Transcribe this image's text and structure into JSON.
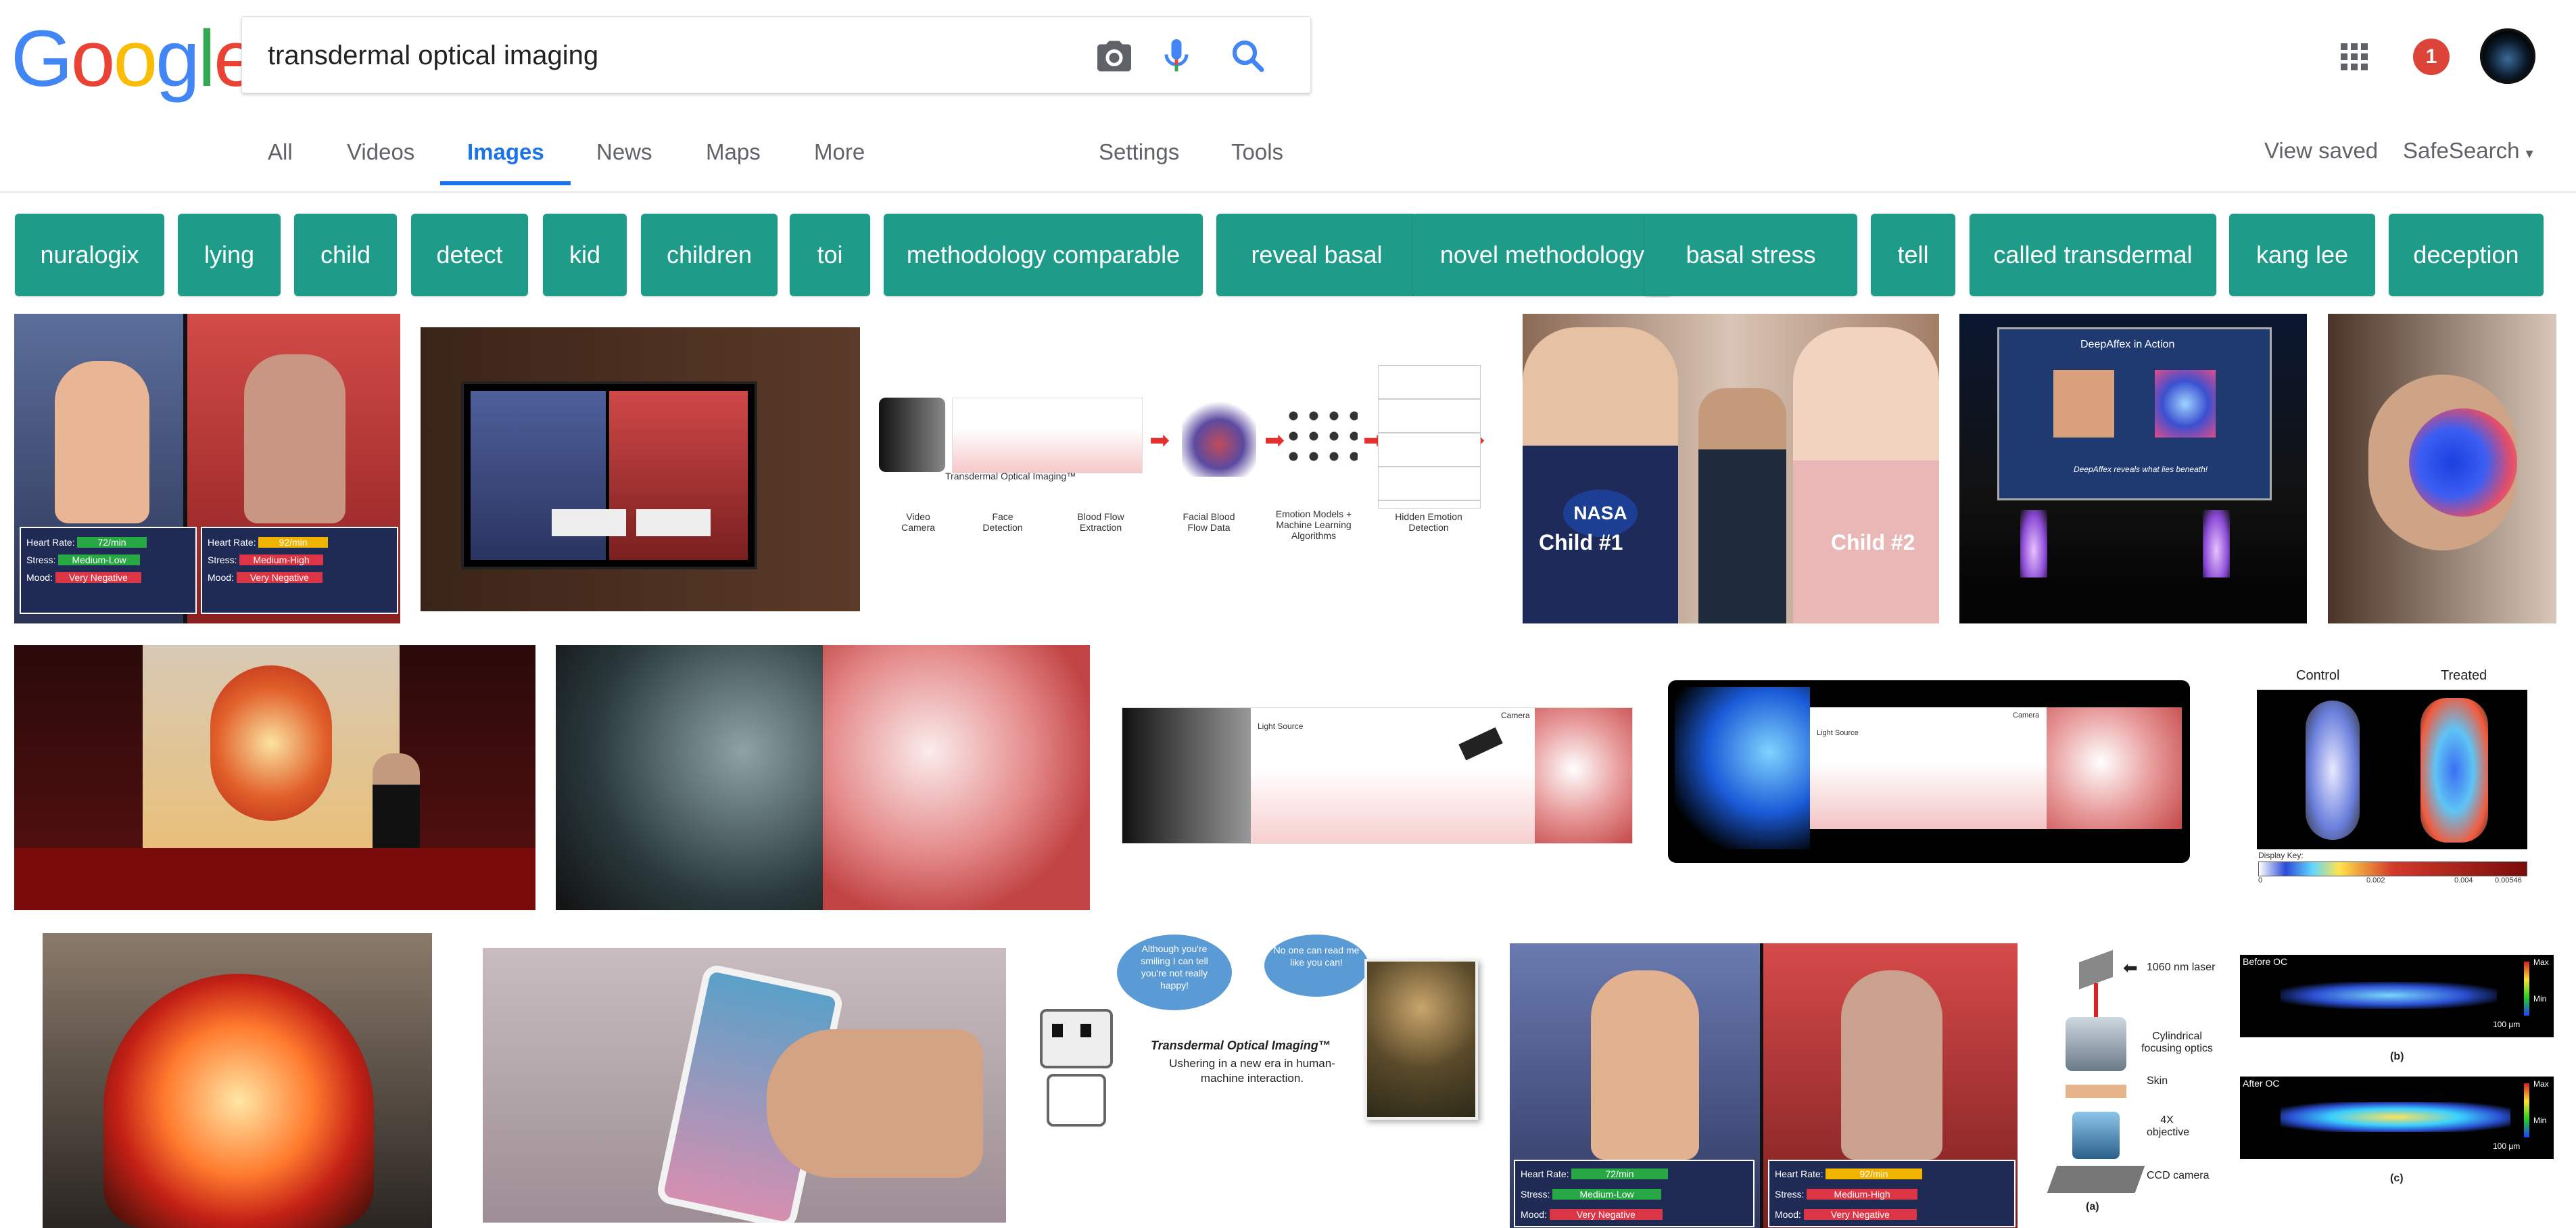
{
  "logo": {
    "letters": [
      "G",
      "o",
      "o",
      "g",
      "l",
      "e"
    ],
    "colors": [
      "#4285F4",
      "#EA4335",
      "#FBBC05",
      "#4285F4",
      "#34A853",
      "#EA4335"
    ]
  },
  "search": {
    "query": "transdermal optical imaging"
  },
  "header": {
    "notification_count": "1"
  },
  "tabs": {
    "all": "All",
    "videos": "Videos",
    "images": "Images",
    "news": "News",
    "maps": "Maps",
    "more": "More",
    "settings": "Settings",
    "tools": "Tools",
    "view_saved": "View saved",
    "safesearch": "SafeSearch"
  },
  "chips": [
    "nuralogix",
    "lying",
    "child",
    "detect",
    "kid",
    "children",
    "toi",
    "methodology comparable",
    "reveal basal",
    "novel methodology",
    "basal stress",
    "tell",
    "called transdermal",
    "kang lee",
    "deception"
  ],
  "images": {
    "r1_debate": {
      "rows": [
        [
          "Heart Rate:",
          "72/min"
        ],
        [
          "Stress:",
          "Medium-Low"
        ],
        [
          "Mood:",
          "Very Negative"
        ]
      ],
      "rows2": [
        [
          "Heart Rate:",
          "92/min"
        ],
        [
          "Stress:",
          "Medium-High"
        ],
        [
          "Mood:",
          "Very Negative"
        ]
      ]
    },
    "r1_diagram": {
      "title": "Transdermal Optical Imaging™",
      "steps": [
        "Video Camera",
        "Face Detection",
        "Blood Flow Extraction",
        "Facial Blood Flow Data",
        "Emotion Models + Machine Learning Algorithms",
        "Hidden Emotion Detection"
      ]
    },
    "r1_kids": {
      "left": "Child #1",
      "right": "Child #2",
      "shirt": "NASA"
    },
    "r1_stage": {
      "slide_title": "DeepAffex in Action",
      "slide_caption": "DeepAffex reveals what lies beneath!"
    },
    "r2_skin": {
      "light": "Light Source",
      "camera": "Camera"
    },
    "r2_treated": {
      "control": "Control",
      "treated": "Treated",
      "key": "Display Key:",
      "ticks": [
        "0",
        "0.002",
        "0.004",
        "0.00546"
      ]
    },
    "r3_cartoon": {
      "bubble1": "Although you're smiling I can tell you're not really happy!",
      "bubble2": "No one can read me like you can!",
      "title": "Transdermal Optical Imaging™",
      "subtitle": "Ushering in a new era in human-machine interaction."
    },
    "r3_debate": {
      "rows": [
        [
          "Heart Rate:",
          "72/min"
        ],
        [
          "Stress:",
          "Medium-Low"
        ],
        [
          "Mood:",
          "Very Negative"
        ]
      ],
      "rows2": [
        [
          "Heart Rate:",
          "92/min"
        ],
        [
          "Stress:",
          "Medium-High"
        ],
        [
          "Mood:",
          "Very Negative"
        ]
      ]
    },
    "r3_optics": {
      "laser": "1060 nm laser",
      "lens": "Cylindrical focusing optics",
      "skin": "Skin",
      "objective": "4X objective",
      "ccd": "CCD camera",
      "a": "(a)",
      "b": "(b)",
      "c": "(c)",
      "before": "Before OC",
      "after": "After OC",
      "max": "Max",
      "min": "Min",
      "scale": "100 µm"
    }
  }
}
